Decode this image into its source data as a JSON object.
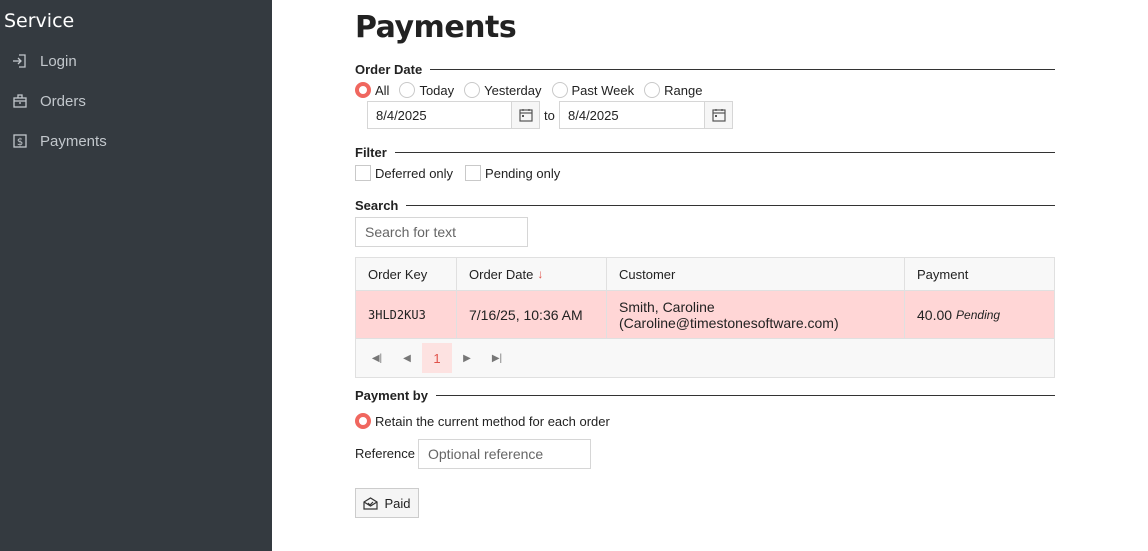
{
  "sidebar": {
    "brand": "Service",
    "items": [
      {
        "label": "Login",
        "icon": "login-icon"
      },
      {
        "label": "Orders",
        "icon": "orders-icon"
      },
      {
        "label": "Payments",
        "icon": "payments-icon"
      }
    ]
  },
  "page": {
    "title": "Payments"
  },
  "order_date": {
    "heading": "Order Date",
    "options": [
      "All",
      "Today",
      "Yesterday",
      "Past Week",
      "Range"
    ],
    "selected": "All",
    "from": "8/4/2025",
    "to_label": "to",
    "to": "8/4/2025"
  },
  "filter": {
    "heading": "Filter",
    "deferred_label": "Deferred only",
    "pending_label": "Pending only"
  },
  "search": {
    "heading": "Search",
    "placeholder": "Search for text"
  },
  "table": {
    "columns": [
      "Order Key",
      "Order Date",
      "Customer",
      "Payment"
    ],
    "sort_column": "Order Date",
    "rows": [
      {
        "order_key": "3HLD2KU3",
        "order_date": "7/16/25, 10:36 AM",
        "customer_name": "Smith, Caroline",
        "customer_email": "(Caroline@timestonesoftware.com)",
        "amount": "40.00",
        "status": "Pending"
      }
    ],
    "current_page": "1"
  },
  "payment_by": {
    "heading": "Payment by",
    "option": "Retain the current method for each order",
    "reference_label": "Reference",
    "reference_placeholder": "Optional reference",
    "paid_label": "Paid"
  },
  "colors": {
    "sidebar_bg": "#343a40",
    "accent": "#f0675f",
    "row_highlight": "#ffd6d6"
  }
}
